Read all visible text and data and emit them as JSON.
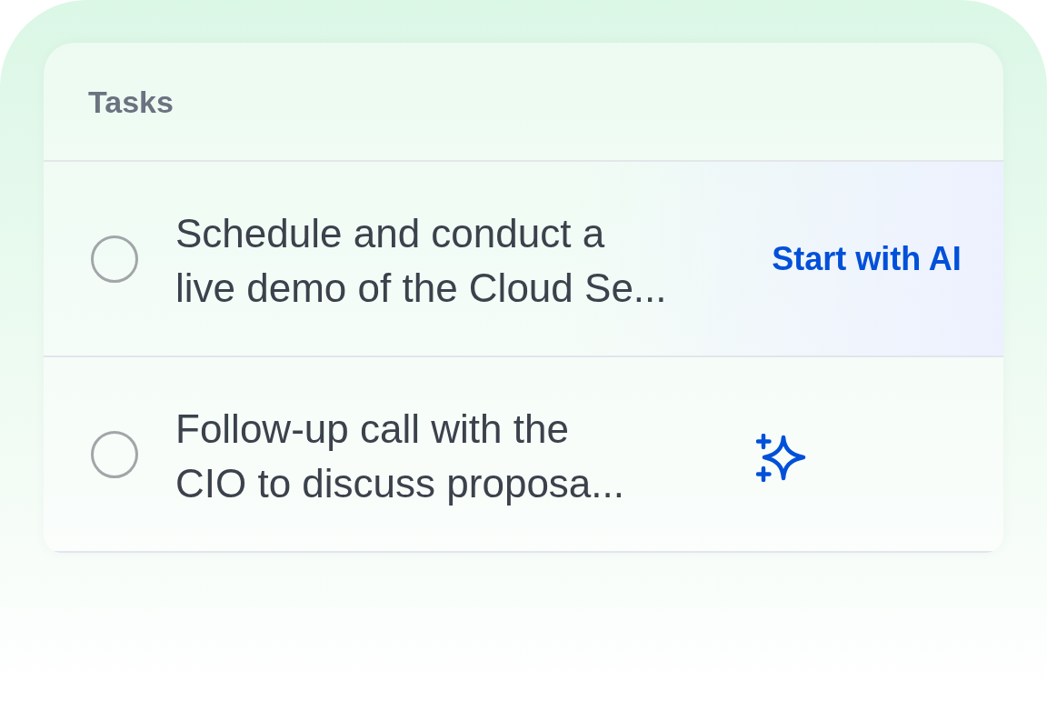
{
  "card": {
    "title": "Tasks"
  },
  "tasks": [
    {
      "title": "Schedule and conduct a\nlive demo of the Cloud Se...",
      "checked": false,
      "hovered": true,
      "action": {
        "kind": "button",
        "label": "Start with AI"
      }
    },
    {
      "title": "Follow-up call with the\nCIO to discuss proposa...",
      "checked": false,
      "hovered": false,
      "action": {
        "kind": "icon"
      }
    }
  ]
}
